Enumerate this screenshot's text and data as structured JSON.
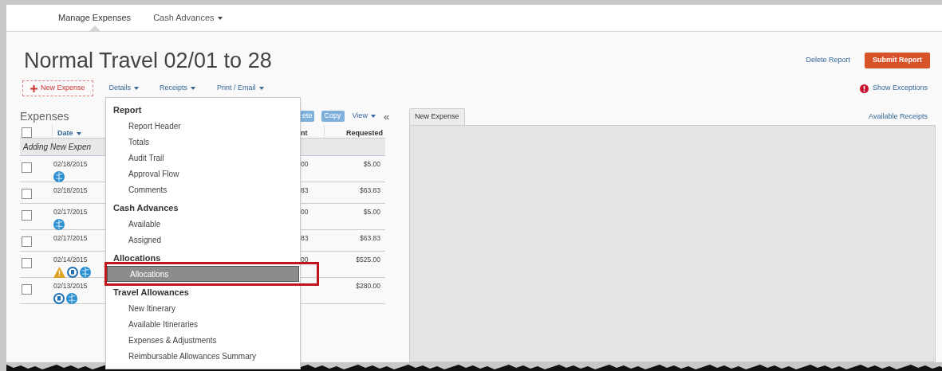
{
  "nav": [
    {
      "label": "Manage Expenses",
      "selected": true,
      "dropdown": false
    },
    {
      "label": "Cash Advances",
      "selected": false,
      "dropdown": true
    }
  ],
  "title": "Normal Travel 02/01 to 28",
  "header_actions": {
    "delete": "Delete Report",
    "submit": "Submit Report"
  },
  "toolbar": {
    "new_expense": "New Expense",
    "menus": [
      "Details",
      "Receipts",
      "Print / Email"
    ],
    "exceptions": "Show Exceptions"
  },
  "expenses": {
    "title": "Expenses",
    "delete_fragment": "ete",
    "copy": "Copy",
    "view": "View",
    "collapse": "«",
    "select_all_checked": false,
    "columns": [
      "Date",
      "nt",
      "Requested"
    ],
    "adding_row": "Adding New Expen",
    "rows": [
      {
        "checked": false,
        "date": "02/18/2015",
        "icons": [
          {
            "kind": "globe"
          }
        ],
        "amount_fragment": "00",
        "requested": "$5.00"
      },
      {
        "checked": false,
        "date": "02/18/2015",
        "icons": [],
        "amount_fragment": "83",
        "requested": "$63.83"
      },
      {
        "checked": false,
        "date": "02/17/2015",
        "icons": [
          {
            "kind": "globe"
          }
        ],
        "amount_fragment": "00",
        "requested": "$5.00"
      },
      {
        "checked": false,
        "date": "02/17/2015",
        "icons": [],
        "amount_fragment": "83",
        "requested": "$63.83"
      },
      {
        "checked": false,
        "date": "02/14/2015",
        "icons": [
          {
            "kind": "warning"
          },
          {
            "kind": "receipt"
          },
          {
            "kind": "globe"
          }
        ],
        "amount_fragment": "00",
        "requested": "$525.00"
      },
      {
        "checked": false,
        "date": "02/13/2015",
        "icons": [
          {
            "kind": "receipt"
          },
          {
            "kind": "globe"
          }
        ],
        "requested": "$280.00"
      }
    ]
  },
  "details_menu": [
    {
      "heading": "Report",
      "items": [
        {
          "label": "Report Header",
          "selected": false
        },
        {
          "label": "Totals",
          "selected": false
        },
        {
          "label": "Audit Trail",
          "selected": false
        },
        {
          "label": "Approval Flow",
          "selected": false
        },
        {
          "label": "Comments",
          "selected": false
        }
      ]
    },
    {
      "heading": "Cash Advances",
      "items": [
        {
          "label": "Available",
          "selected": false
        },
        {
          "label": "Assigned",
          "selected": false
        }
      ]
    },
    {
      "heading": "Allocations",
      "items": [
        {
          "label": "Allocations",
          "selected": true
        }
      ]
    },
    {
      "heading": "Travel Allowances",
      "items": [
        {
          "label": "New Itinerary",
          "selected": false
        },
        {
          "label": "Available Itineraries",
          "selected": false
        },
        {
          "label": "Expenses & Adjustments",
          "selected": false
        },
        {
          "label": "Reimbursable Allowances Summary",
          "selected": false
        }
      ]
    }
  ],
  "right_panel": {
    "tabs": [
      {
        "label": "New Expense",
        "selected": true
      }
    ],
    "link": "Available Receipts"
  }
}
